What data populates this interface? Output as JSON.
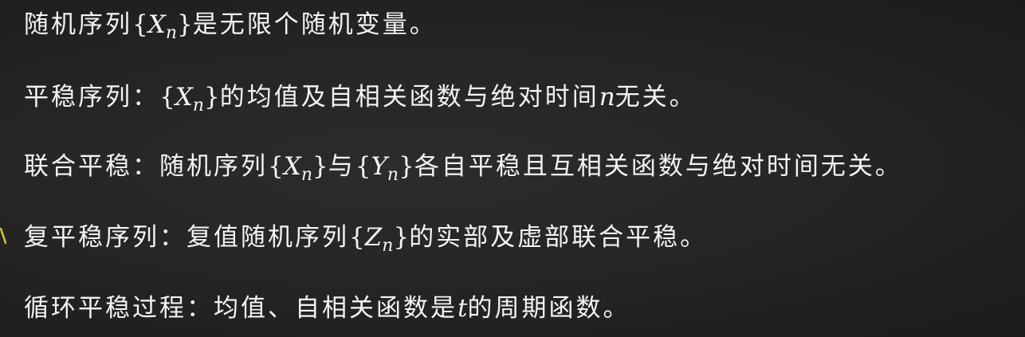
{
  "lines": [
    {
      "pre": "随机序列",
      "var": "X",
      "sub": "n",
      "post": "是无限个随机变量。"
    },
    {
      "pre": "平稳序列：",
      "var": "X",
      "sub": "n",
      "mid": "的均值及自相关函数与绝对时间",
      "var2": "n",
      "post": "无关。"
    },
    {
      "pre": "联合平稳：随机序列",
      "var": "X",
      "sub": "n",
      "mid": "与",
      "var2": "Y",
      "sub2": "n",
      "post": "各自平稳且互相关函数与绝对时间无关。"
    },
    {
      "pre": "复平稳序列：复值随机序列",
      "var": "Z",
      "sub": "n",
      "post": "的实部及虚部联合平稳。"
    },
    {
      "pre": "循环平稳过程：均值、自相关函数是",
      "var": "t",
      "post": "的周期函数。"
    }
  ],
  "braces": {
    "open": "{",
    "close": "}"
  },
  "colors": {
    "background": "#262626",
    "text": "#f4f4f4",
    "tick": "#d4c23a"
  }
}
